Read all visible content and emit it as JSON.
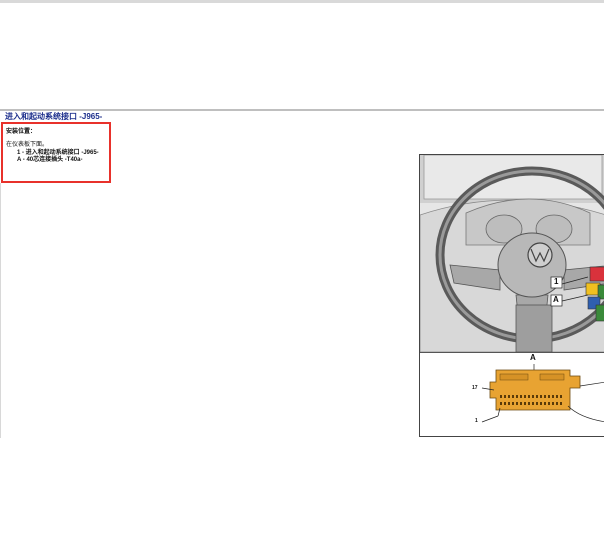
{
  "doc": {
    "title": "进入和起动系统接口 -J965-",
    "section_label": "安装位置：",
    "location_text": "在仪表板下面。",
    "items": [
      {
        "text": "1 - 进入和起动系统接口 -J965-"
      },
      {
        "text": "A - 40芯连接插头 -T40a-"
      }
    ]
  },
  "figure": {
    "callout_1": "1",
    "callout_a": "A",
    "connector_label": "A",
    "pin_17": "17",
    "pin_1": "1"
  }
}
